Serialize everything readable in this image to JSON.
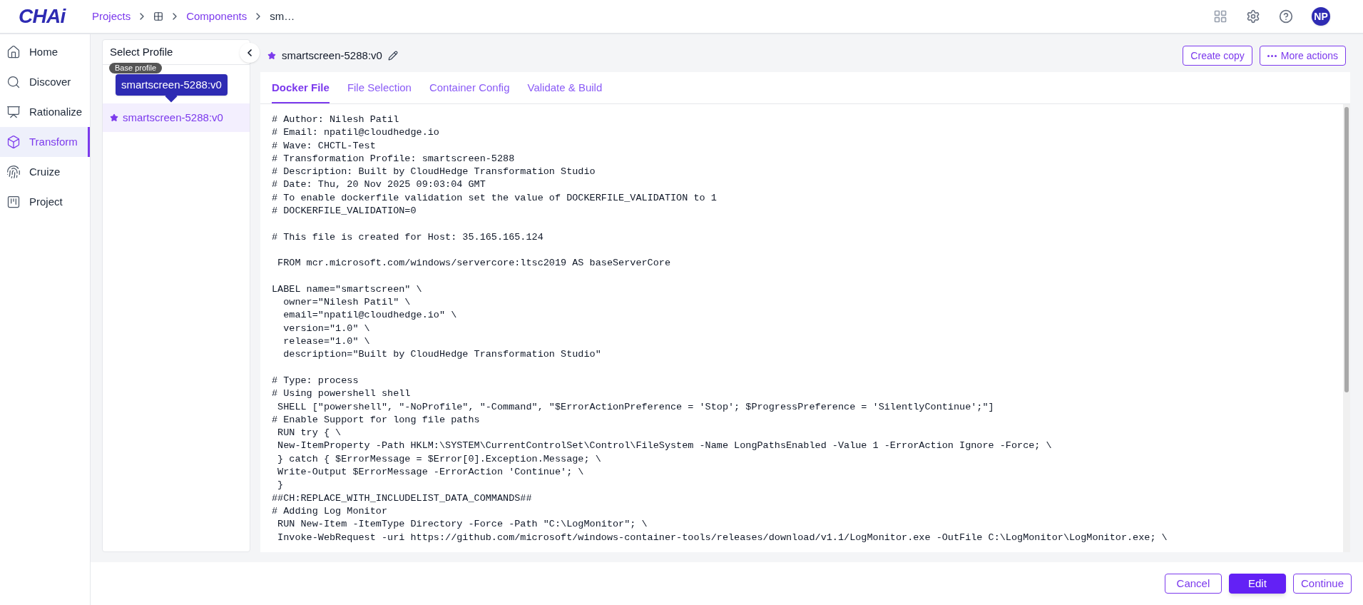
{
  "logo": "CHAi",
  "breadcrumbs": [
    {
      "label": "Projects",
      "kind": "link"
    },
    {
      "kind": "grid"
    },
    {
      "label": "Components",
      "kind": "link"
    },
    {
      "label": "sm…",
      "kind": "current"
    }
  ],
  "user": {
    "initials": "NP"
  },
  "nav": [
    {
      "label": "Home",
      "selected": false
    },
    {
      "label": "Discover",
      "selected": false
    },
    {
      "label": "Rationalize",
      "selected": false
    },
    {
      "label": "Transform",
      "selected": true
    },
    {
      "label": "Cruize",
      "selected": false
    },
    {
      "label": "Project",
      "selected": false
    }
  ],
  "profile_panel": {
    "title": "Select Profile",
    "badge": "Base profile",
    "tooltip": "smartscreen-5288:v0",
    "items": [
      {
        "label": "smartscreen-5288:v0",
        "starred": true,
        "selected": true
      }
    ]
  },
  "component": {
    "title": "smartscreen-5288:v0",
    "starred": true
  },
  "actions": [
    "Create copy",
    "More actions"
  ],
  "tabs": [
    {
      "label": "Docker File",
      "selected": true
    },
    {
      "label": "File Selection",
      "selected": false
    },
    {
      "label": "Container Config",
      "selected": false
    },
    {
      "label": "Validate & Build",
      "selected": false
    }
  ],
  "code_blocks": [
    [
      "# Author: Nilesh Patil",
      "# Email: npatil@cloudhedge.io",
      "# Wave: CHCTL-Test",
      "# Transformation Profile: smartscreen-5288",
      "# Description: Built by CloudHedge Transformation Studio",
      "# Date: Thu, 20 Nov 2025 09:03:04 GMT",
      "# To enable dockerfile validation set the value of DOCKERFILE_VALIDATION to 1",
      "# DOCKERFILE_VALIDATION=0"
    ],
    [
      "# This file is created for Host: 35.165.165.124"
    ],
    [
      " FROM mcr.microsoft.com/windows/servercore:ltsc2019 AS baseServerCore"
    ],
    [
      "LABEL name=\"smartscreen\" \\",
      "  owner=\"Nilesh Patil\" \\",
      "  email=\"npatil@cloudhedge.io\" \\",
      "  version=\"1.0\" \\",
      "  release=\"1.0\" \\",
      "  description=\"Built by CloudHedge Transformation Studio\""
    ],
    [
      "# Type: process",
      "# Using powershell shell",
      " SHELL [\"powershell\", \"-NoProfile\", \"-Command\", \"$ErrorActionPreference = 'Stop'; $ProgressPreference = 'SilentlyContinue';\"]",
      "# Enable Support for long file paths",
      " RUN try { \\",
      " New-ItemProperty -Path HKLM:\\SYSTEM\\CurrentControlSet\\Control\\FileSystem -Name LongPathsEnabled -Value 1 -ErrorAction Ignore -Force; \\",
      " } catch { $ErrorMessage = $Error[0].Exception.Message; \\",
      " Write-Output $ErrorMessage -ErrorAction 'Continue'; \\",
      " }",
      "##CH:REPLACE_WITH_INCLUDELIST_DATA_COMMANDS##",
      "# Adding Log Monitor",
      " RUN New-Item -ItemType Directory -Force -Path \"C:\\LogMonitor\"; \\",
      " Invoke-WebRequest -uri https://github.com/microsoft/windows-container-tools/releases/download/v1.1/LogMonitor.exe -OutFile C:\\LogMonitor\\LogMonitor.exe; \\"
    ]
  ],
  "footer_buttons": [
    {
      "label": "Cancel",
      "kind": "outline"
    },
    {
      "label": "Edit",
      "kind": "primary"
    },
    {
      "label": "Continue",
      "kind": "outline"
    }
  ]
}
